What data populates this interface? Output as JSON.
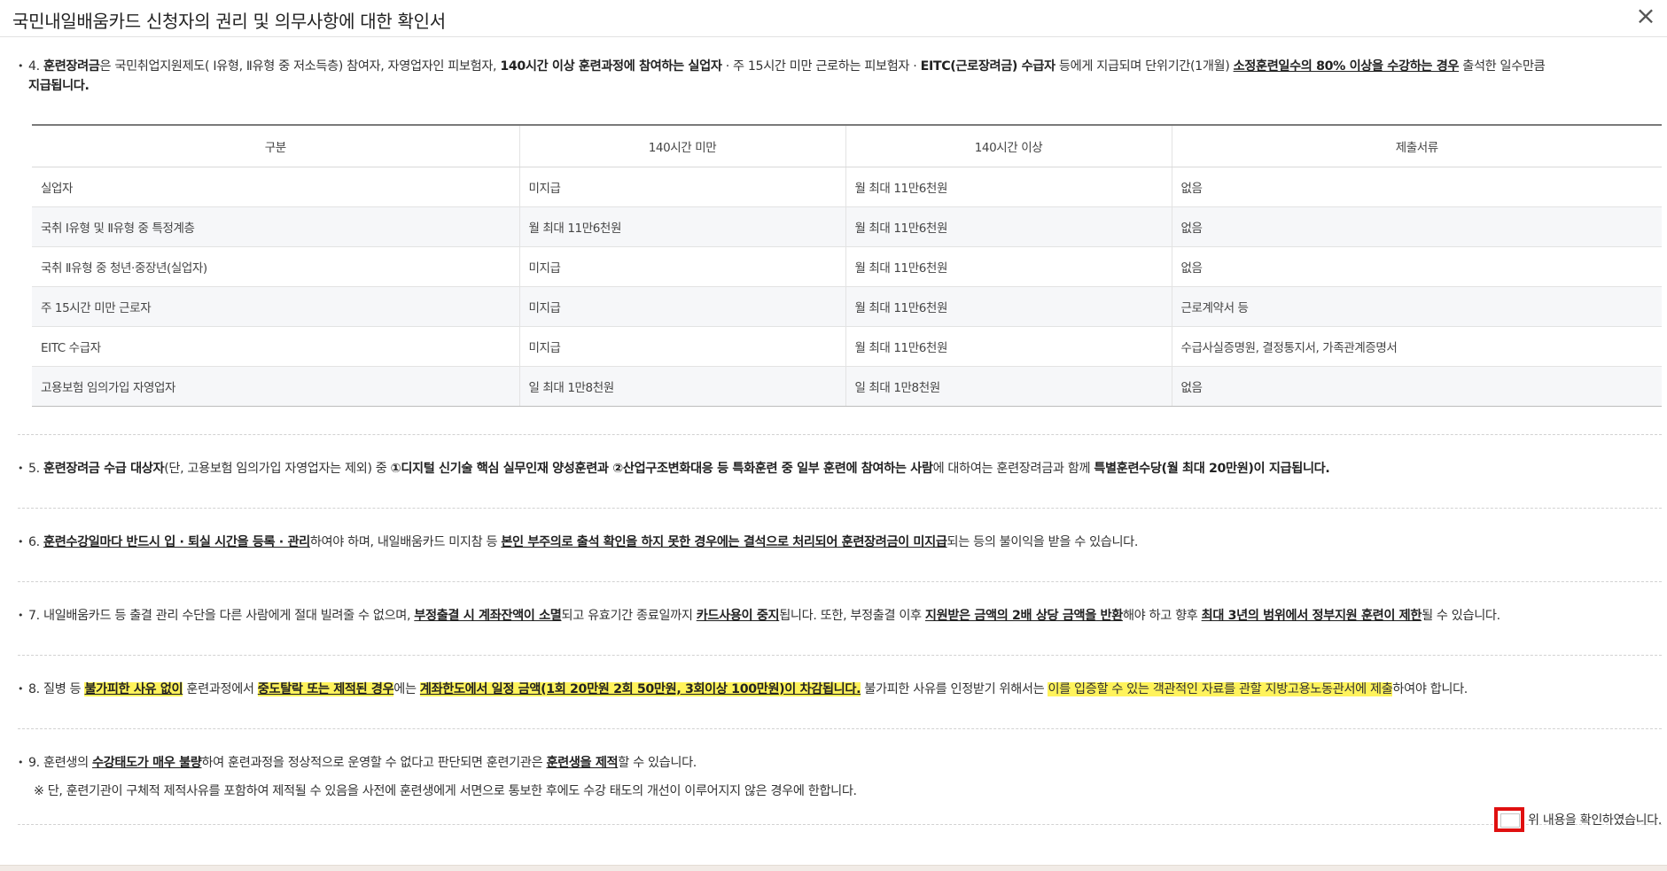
{
  "dialog": {
    "title": "국민내일배움카드 신청자의 권리 및 의무사항에 대한 확인서",
    "close_glyph": "×"
  },
  "bullet_glyph": "•",
  "item4": {
    "p1": "4. ",
    "p2": "훈련장려금",
    "p3": "은 국민취업지원제도( Ⅰ유형, Ⅱ유형 중 저소득층) 참여자, 자영업자인 피보험자, ",
    "p4": "140시간 이상 훈련과정에 참여하는 실업자",
    "p5": " · 주 15시간 미만 근로하는 피보험자 · ",
    "p6": "EITC(근로장려금) 수급자",
    "p7": " 등에게 지급되며 단위기간(1개월) ",
    "p8": "소정훈련일수의 80% 이상을 수강하는 경우",
    "p9": " 출석한 일수만큼 ",
    "p10": "지급됩니다."
  },
  "table": {
    "headers": [
      "구분",
      "140시간 미만",
      "140시간 이상",
      "제출서류"
    ],
    "rows": [
      [
        "실업자",
        "미지급",
        "월 최대 11만6천원",
        "없음"
      ],
      [
        "국취 Ⅰ유형 및 Ⅱ유형 중 특정계층",
        "월 최대 11만6천원",
        "월 최대 11만6천원",
        "없음"
      ],
      [
        "국취 Ⅱ유형 중 청년·중장년(실업자)",
        "미지급",
        "월 최대 11만6천원",
        "없음"
      ],
      [
        "주 15시간 미만 근로자",
        "미지급",
        "월 최대 11만6천원",
        "근로계약서 등"
      ],
      [
        "EITC 수급자",
        "미지급",
        "월 최대 11만6천원",
        "수급사실증명원, 결정통지서, 가족관계증명서"
      ],
      [
        "고용보험 임의가입 자영업자",
        "일 최대 1만8천원",
        "일 최대 1만8천원",
        "없음"
      ]
    ]
  },
  "item5": {
    "p1": "5. ",
    "p2": "훈련장려금 수급 대상자",
    "p3": "(단, 고용보험 임의가입 자영업자는 제외) 중 ",
    "p4": "①디지털 신기술 핵심 실무인재 양성훈련과 ②산업구조변화대응 등 특화훈련 중 일부 훈련에 참여하는 사람",
    "p5": "에 대하여는 훈련장려금과 함께 ",
    "p6": "특별훈련수당(월 최대 20만원)이 지급",
    "p7": "됩니다."
  },
  "item6": {
    "p1": "6. ",
    "p2": "훈련수강일마다 반드시 입 · 퇴실 시간을 등록 · 관리",
    "p3": "하여야 하며, 내일배움카드 미지참 등 ",
    "p4": "본인 부주의로 출석 확인을 하지 못한 경우에는 결석으로 처리되어 훈련장려금이 미지급",
    "p5": "되는 등의 불이익을 받을 수 있습니다."
  },
  "item7": {
    "p1": "7. 내일배움카드 등 출결 관리 수단을 다른 사람에게 절대 빌려줄 수 없으며, ",
    "p2": "부정출결 시 계좌잔액이 소멸",
    "p3": "되고 유효기간 종료일까지 ",
    "p4": "카드사용이 중지",
    "p5": "됩니다. 또한, 부정출결 이후 ",
    "p6": "지원받은 금액의 2배 상당 금액을 반환",
    "p7": "해야 하고 향후 ",
    "p8": "최대 3년의 범위에서 정부지원 훈련이 제한",
    "p9": "될 수 있습니다."
  },
  "item8": {
    "p1": "8. 질병 등 ",
    "p2": "불가피한 사유 없이",
    "p3": " 훈련과정에서 ",
    "p4": "중도탈락 또는 제적된 경우",
    "p5": "에는 ",
    "p6": "계좌한도에서 일정 금액(1회 20만원 2회 50만원, 3회이상 100만원)이 차감됩니다.",
    "p7": " 불가피한 사유를 인정받기 위해서는 ",
    "p8": "이를 입증할 수 있는 객관적인 자료를 관할 지방고용노동관서에 제출",
    "p9": "하여야 합니다."
  },
  "item9": {
    "p1": "9. 훈련생의 ",
    "p2": "수강태도가 매우 불량",
    "p3": "하여 훈련과정을 정상적으로 운영할 수 없다고 판단되면 훈련기관은 ",
    "p4": "훈련생을 제적",
    "p5": "할 수 있습니다.",
    "note": "※ 단, 훈련기관이 구체적 제적사유를 포함하여 제적될 수 있음을 사전에 훈련생에게 서면으로 통보한 후에도 수강 태도의 개선이 이루어지지 않은 경우에 한합니다."
  },
  "confirm": {
    "label": "위 내용을 확인하였습니다.",
    "checked": false,
    "highlight_color": "#e01010"
  },
  "colors": {
    "highlight": "#fff35c",
    "confirm_border": "#e01010"
  }
}
